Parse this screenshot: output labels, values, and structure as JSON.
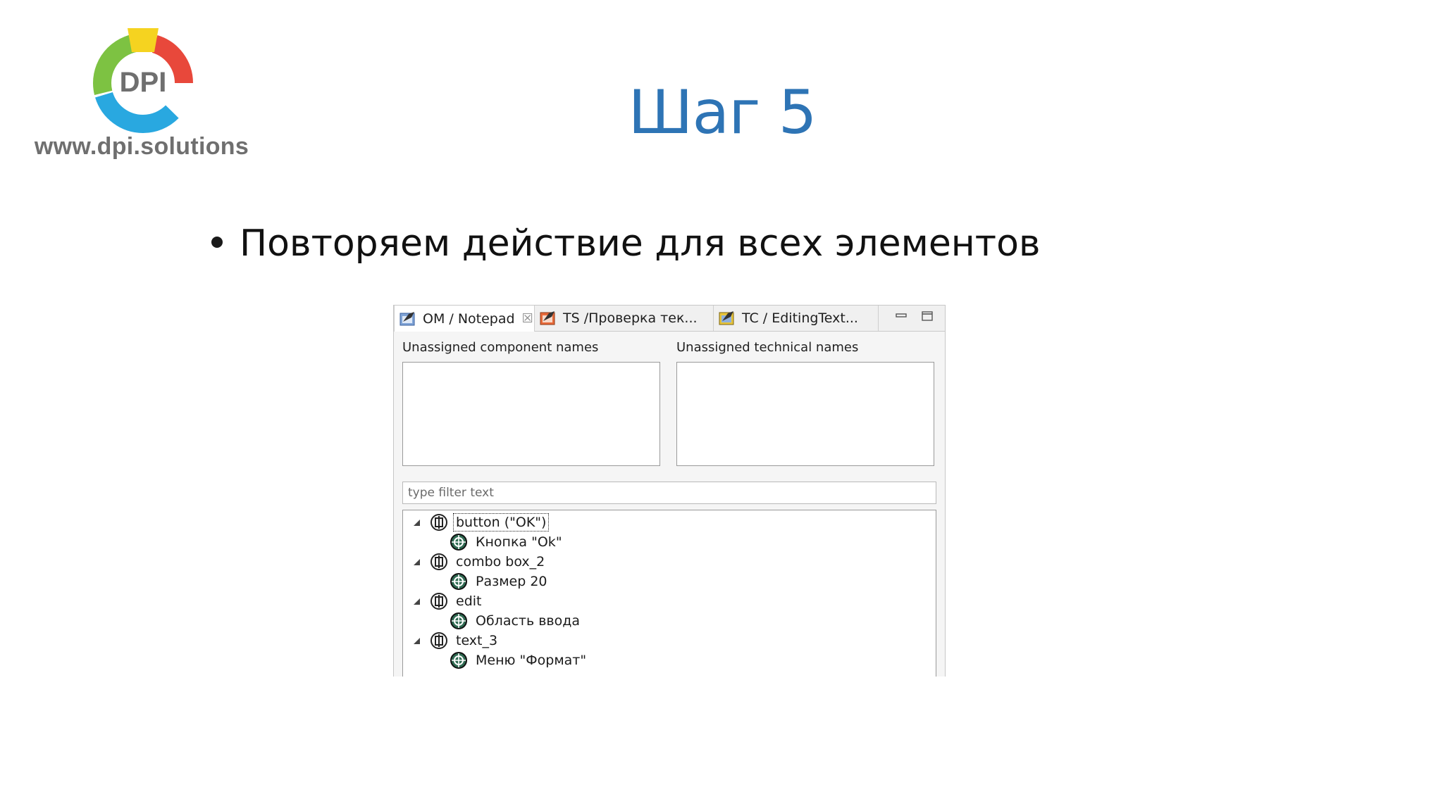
{
  "logo": {
    "brand_text": "DPI",
    "site_url": "www.dpi.solutions"
  },
  "slide": {
    "title": "Шаг 5",
    "bullet": "Повторяем действие для всех элементов"
  },
  "screenshot": {
    "tabs": [
      {
        "label": "OM / Notepad",
        "icon": "object-map-icon",
        "active": true,
        "closable": true
      },
      {
        "label": "TS /Проверка тек...",
        "icon": "test-suite-icon",
        "active": false
      },
      {
        "label": "TC / EditingText...",
        "icon": "test-case-icon",
        "active": false
      }
    ],
    "window_buttons": [
      "minimize-icon",
      "maximize-icon"
    ],
    "unassigned_component_label": "Unassigned component names",
    "unassigned_technical_label": "Unassigned technical names",
    "filter_placeholder": "type filter text",
    "tree": [
      {
        "label": "button (\"OK\")",
        "child": "Кнопка \"Ok\"",
        "focused": true
      },
      {
        "label": "combo box_2",
        "child": "Размер 20"
      },
      {
        "label": "edit",
        "child": "Область ввода"
      },
      {
        "label": "text_3",
        "child": "Меню \"Формат\""
      }
    ]
  },
  "colors": {
    "title": "#2e74b5",
    "logo_green": "#7dc242",
    "logo_red": "#e8483b",
    "logo_blue": "#29a8e0",
    "logo_yellow": "#f5d320",
    "logo_text": "#6f6f6f"
  }
}
